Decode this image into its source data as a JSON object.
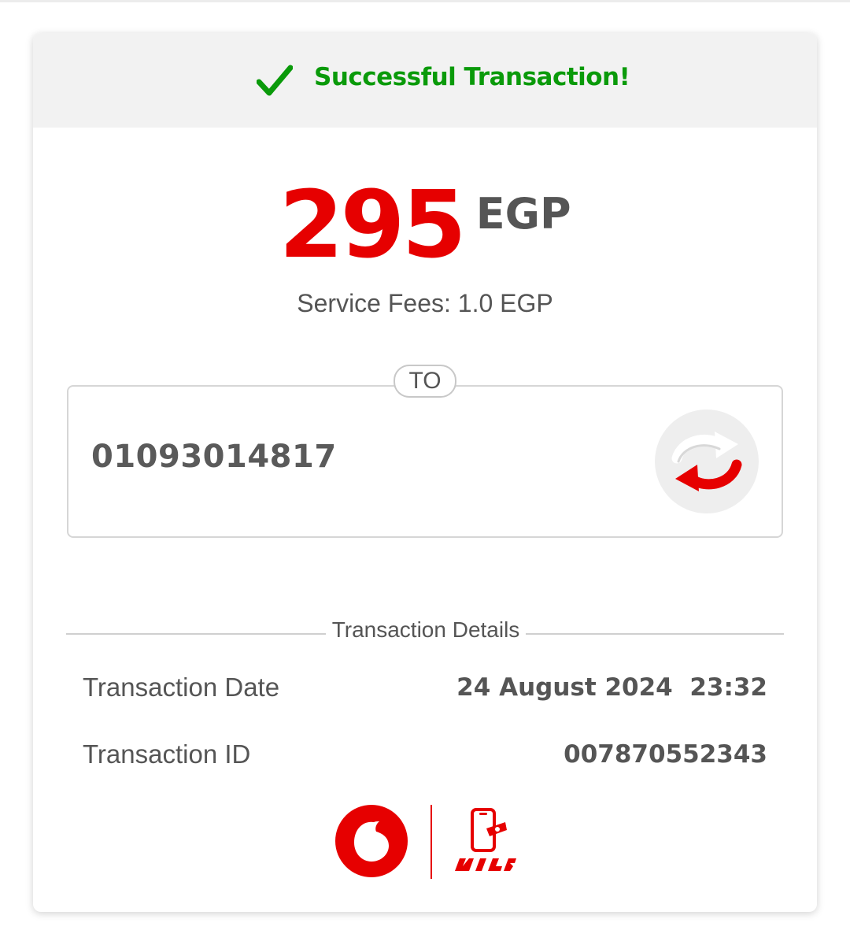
{
  "status": {
    "message": "Successful Transaction!",
    "icon": "check-icon",
    "color": "#0a9a0a"
  },
  "amount": {
    "value": "295",
    "currency": "EGP",
    "color": "#e60000"
  },
  "fees": {
    "text": "Service Fees: 1.0 EGP"
  },
  "recipient": {
    "label": "TO",
    "number": "01093014817",
    "action_icon": "swap-arrows-icon"
  },
  "details": {
    "title": "Transaction Details",
    "rows": [
      {
        "label": "Transaction Date",
        "value": "24 August 2024  23:32"
      },
      {
        "label": "Transaction ID",
        "value": "007870552343"
      }
    ]
  },
  "branding": {
    "logos": [
      "vodafone-logo",
      "vodafone-cash-logo"
    ],
    "brand_color": "#e60000"
  }
}
